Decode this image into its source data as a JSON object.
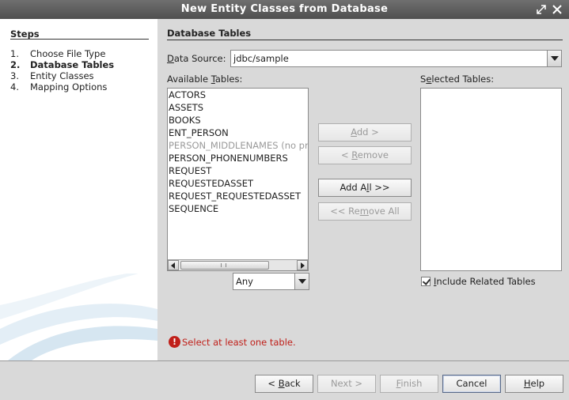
{
  "window": {
    "title": "New Entity Classes from Database"
  },
  "steps": {
    "heading": "Steps",
    "items": [
      {
        "num": "1.",
        "label": "Choose File Type"
      },
      {
        "num": "2.",
        "label": "Database Tables"
      },
      {
        "num": "3.",
        "label": "Entity Classes"
      },
      {
        "num": "4.",
        "label": "Mapping Options"
      }
    ],
    "current_index": 1
  },
  "panel": {
    "heading": "Database Tables",
    "data_source_label": "Data Source:",
    "data_source_value": "jdbc/sample",
    "available_label": "Available Tables:",
    "selected_label": "Selected Tables:",
    "available_tables": [
      {
        "name": "ACTORS",
        "enabled": true
      },
      {
        "name": "ASSETS",
        "enabled": true
      },
      {
        "name": "BOOKS",
        "enabled": true
      },
      {
        "name": "ENT_PERSON",
        "enabled": true
      },
      {
        "name": "PERSON_MIDDLENAMES (no primary key)",
        "enabled": false
      },
      {
        "name": "PERSON_PHONENUMBERS",
        "enabled": true
      },
      {
        "name": "REQUEST",
        "enabled": true
      },
      {
        "name": "REQUESTEDASSET",
        "enabled": true
      },
      {
        "name": "REQUEST_REQUESTEDASSET",
        "enabled": true
      },
      {
        "name": "SEQUENCE",
        "enabled": true
      }
    ],
    "selected_tables": [],
    "filter_value": "Any",
    "buttons": {
      "add": "Add >",
      "remove": "< Remove",
      "add_all": "Add All >>",
      "remove_all": "<< Remove All"
    },
    "include_related": {
      "label": "Include Related Tables",
      "checked": true
    },
    "error_message": "Select at least one table."
  },
  "footer": {
    "back": "< Back",
    "next": "Next >",
    "finish": "Finish",
    "cancel": "Cancel",
    "help": "Help"
  },
  "colors": {
    "titlebar": "#5f5f5f",
    "error": "#c0201a",
    "panel_bg": "#d9d9d9"
  }
}
